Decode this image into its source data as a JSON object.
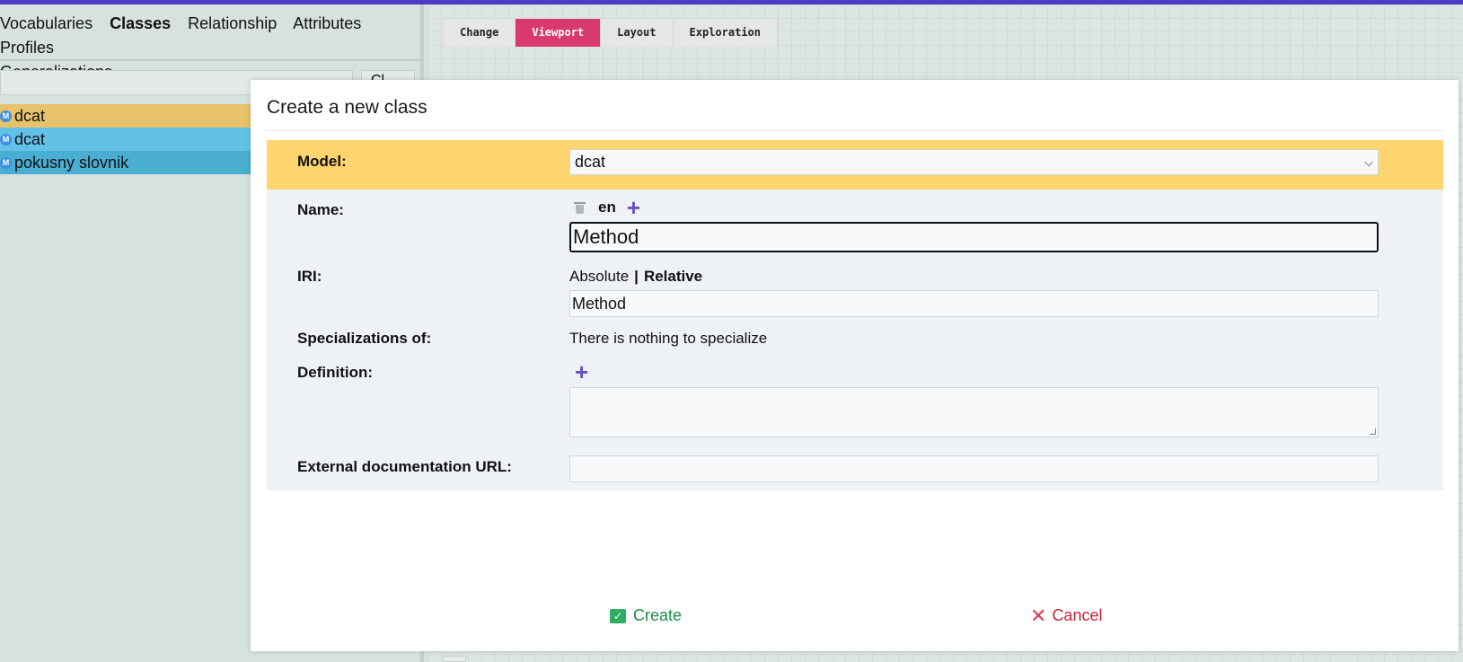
{
  "colors": {
    "topbar": "#4b3bc7",
    "active_tab": "#d83a6e",
    "model_row": "#fed56e",
    "create": "#1e8b4a",
    "cancel": "#c8223c"
  },
  "left_nav": {
    "tabs": [
      "Vocabularies",
      "Classes",
      "Relationship",
      "Attributes",
      "Profiles",
      "Generalizations"
    ],
    "active": "Classes",
    "clear_label": "Cl"
  },
  "vocabularies": [
    {
      "label": "dcat",
      "color": "#e7c26a",
      "icon": "model-icon"
    },
    {
      "label": "dcat",
      "color": "#63c1e8",
      "icon": "model-icon"
    },
    {
      "label": "pokusny slovnik",
      "color": "#4aaed3",
      "icon": "model-icon"
    }
  ],
  "toolbar": {
    "buttons": [
      "Change",
      "Viewport",
      "Layout",
      "Exploration"
    ],
    "active": "Viewport"
  },
  "dialog": {
    "title": "Create a new class",
    "model_label": "Model:",
    "model_value": "dcat",
    "name_label": "Name:",
    "name_lang": "en",
    "name_value": "Method",
    "iri_label": "IRI:",
    "iri_absolute": "Absolute",
    "iri_separator": "|",
    "iri_relative": "Relative",
    "iri_value": "Method",
    "spec_label": "Specializations of:",
    "spec_text": "There is nothing to specialize",
    "definition_label": "Definition:",
    "ext_doc_label": "External documentation URL:",
    "ext_doc_value": "",
    "create_label": "Create",
    "cancel_label": "Cancel"
  }
}
